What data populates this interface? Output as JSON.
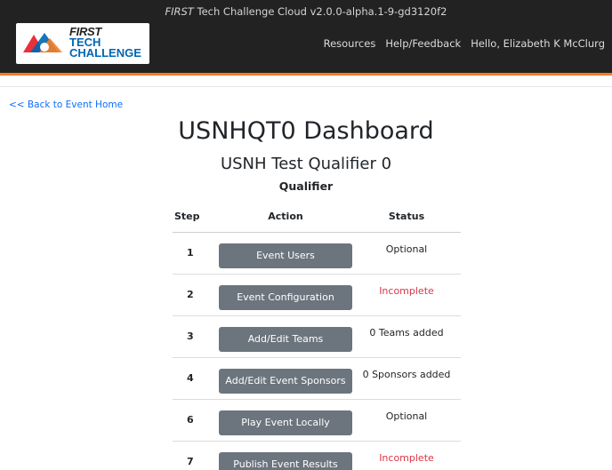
{
  "header": {
    "version_brand": "FIRST",
    "version_rest": " Tech Challenge Cloud v2.0.0-alpha.1-9-gd3120f2",
    "logo": {
      "line1": "FIRST",
      "line2": "TECH",
      "line3": "CHALLENGE"
    },
    "nav": {
      "resources": "Resources",
      "help": "Help/Feedback",
      "user": "Hello, Elizabeth K McClurg"
    }
  },
  "back_link": "<< Back to Event Home",
  "page": {
    "title": "USNHQT0 Dashboard",
    "event_name": "USNH Test Qualifier 0",
    "event_type": "Qualifier"
  },
  "table": {
    "headers": {
      "step": "Step",
      "action": "Action",
      "status": "Status"
    },
    "rows": [
      {
        "step": "1",
        "action": "Event Users",
        "status": "Optional"
      },
      {
        "step": "2",
        "action": "Event Configuration",
        "status": "Incomplete"
      },
      {
        "step": "3",
        "action": "Add/Edit Teams",
        "status": "0 Teams added"
      },
      {
        "step": "4",
        "action": "Add/Edit Event Sponsors",
        "status": "0 Sponsors added"
      },
      {
        "step": "6",
        "action": "Play Event Locally",
        "status": "Optional"
      },
      {
        "step": "7",
        "action": "Publish Event Results",
        "status": "Incomplete"
      }
    ]
  },
  "colors": {
    "header_bg": "#222222",
    "accent": "#f57e25",
    "link": "#0d6efd",
    "button": "#6c757d",
    "incomplete": "#dc3545"
  }
}
